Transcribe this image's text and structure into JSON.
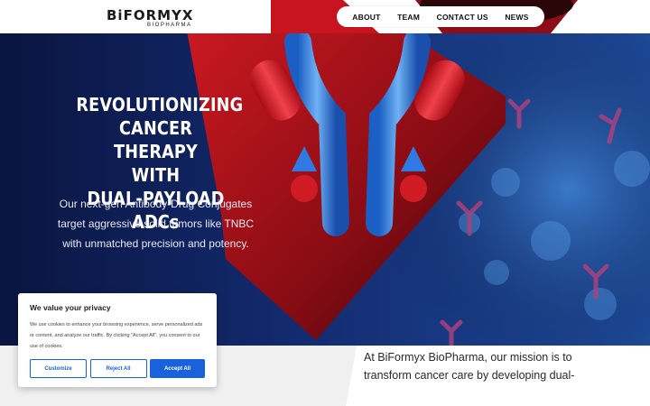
{
  "header": {
    "logo_text": "BiFORMYX",
    "logo_subtext": "BIOPHARMA",
    "nav": [
      "ABOUT",
      "TEAM",
      "CONTACT US",
      "NEWS"
    ]
  },
  "hero": {
    "title_lines": [
      "REVOLUTIONIZING",
      "CANCER THERAPY",
      "WITH",
      "DUAL-PAYLOAD ADCs"
    ],
    "subtitle_lines": [
      "Our next-gen Antibody-Drug Conjugates",
      "target aggressive solid tumors like TNBC",
      "with unmatched precision and potency."
    ]
  },
  "mission": {
    "lines": [
      "At BiFormyx BioPharma, our mission is to",
      "transform cancer care by developing dual-"
    ]
  },
  "cookie_banner": {
    "title": "We value your privacy",
    "text": "We use cookies to enhance your browsing experience, serve personalized ads or content, and analyze our traffic. By clicking \"Accept All\", you consent to our use of cookies.",
    "buttons": {
      "customize": "Customize",
      "reject": "Reject All",
      "accept": "Accept All"
    }
  },
  "colors": {
    "brand_red": "#c8141e",
    "hero_navy": "#0d1a45",
    "cookie_blue": "#1863dc"
  }
}
